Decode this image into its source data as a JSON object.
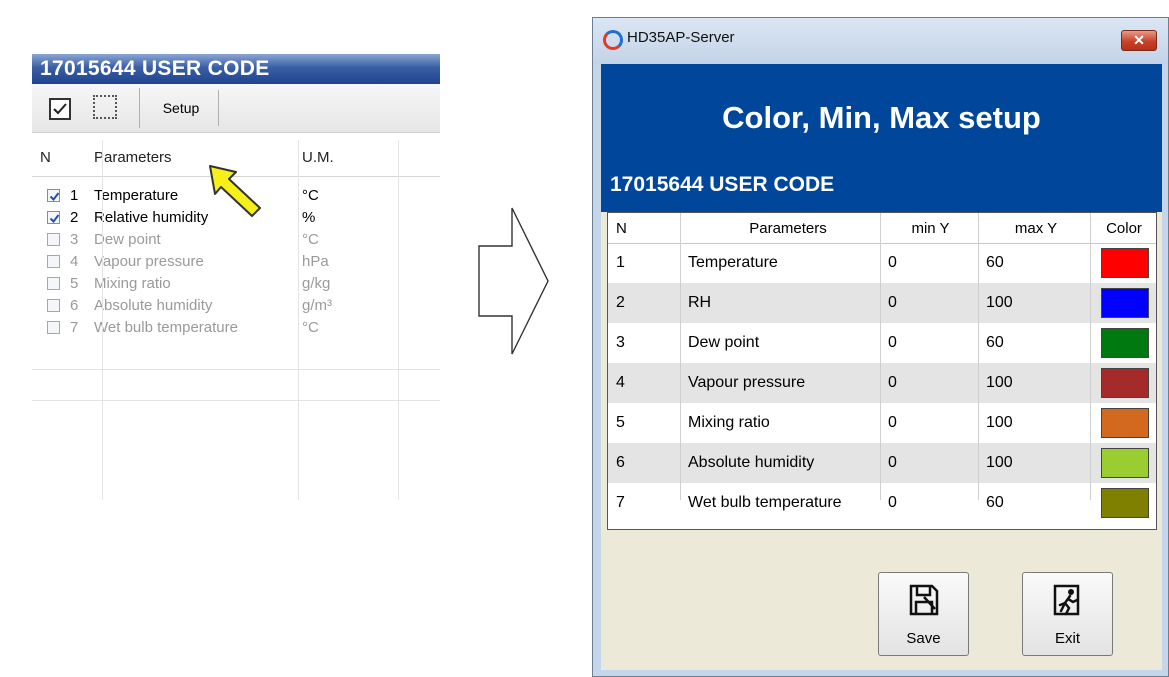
{
  "left": {
    "title": "17015644 USER CODE",
    "toolbar": {
      "setup_label": "Setup"
    },
    "headers": {
      "n": "N",
      "parameters": "Parameters",
      "um": "U.M."
    },
    "rows": [
      {
        "num": "1",
        "param": "Temperature",
        "unit": "°C",
        "checked": true
      },
      {
        "num": "2",
        "param": "Relative humidity",
        "unit": "%",
        "checked": true
      },
      {
        "num": "3",
        "param": "Dew point",
        "unit": "°C",
        "checked": false
      },
      {
        "num": "4",
        "param": "Vapour pressure",
        "unit": "hPa",
        "checked": false
      },
      {
        "num": "5",
        "param": "Mixing ratio",
        "unit": "g/kg",
        "checked": false
      },
      {
        "num": "6",
        "param": "Absolute humidity",
        "unit": "g/m³",
        "checked": false
      },
      {
        "num": "7",
        "param": "Wet bulb temperature",
        "unit": "°C",
        "checked": false
      }
    ]
  },
  "dialog": {
    "window_title": "HD35AP-Server",
    "close_label": "✕",
    "header_title": "Color, Min, Max setup",
    "user_code": "17015644 USER CODE",
    "headers": {
      "n": "N",
      "parameters": "Parameters",
      "min": "min Y",
      "max": "max Y",
      "color": "Color"
    },
    "rows": [
      {
        "n": "1",
        "param": "Temperature",
        "min": "0",
        "max": "60",
        "color": "#ff0000"
      },
      {
        "n": "2",
        "param": "RH",
        "min": "0",
        "max": "100",
        "color": "#0000ff"
      },
      {
        "n": "3",
        "param": "Dew point",
        "min": "0",
        "max": "60",
        "color": "#007a10"
      },
      {
        "n": "4",
        "param": "Vapour pressure",
        "min": "0",
        "max": "100",
        "color": "#a52a2a"
      },
      {
        "n": "5",
        "param": "Mixing ratio",
        "min": "0",
        "max": "100",
        "color": "#d2691e"
      },
      {
        "n": "6",
        "param": "Absolute humidity",
        "min": "0",
        "max": "100",
        "color": "#9acd32"
      },
      {
        "n": "7",
        "param": "Wet bulb temperature",
        "min": "0",
        "max": "60",
        "color": "#808000"
      }
    ],
    "save_label": "Save",
    "exit_label": "Exit"
  },
  "icons": {
    "check": "checkbox-checked-icon",
    "select_none": "dotted-select-icon",
    "cursor": "cursor-arrow-icon",
    "arrow": "right-arrow-icon",
    "save": "save-icon",
    "exit": "exit-icon"
  }
}
